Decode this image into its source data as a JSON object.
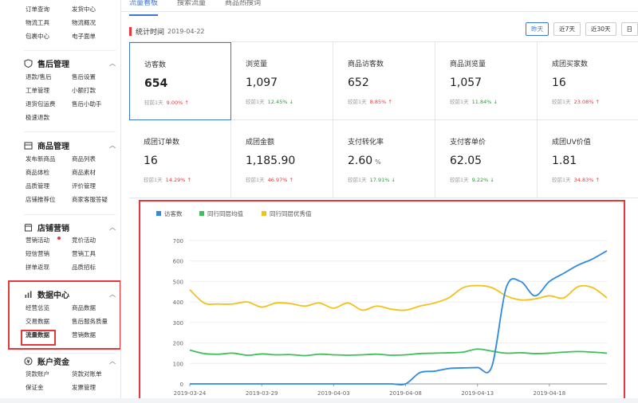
{
  "sidebar": {
    "top_links": [
      "订单查询",
      "发货中心",
      "物流工具",
      "物流概况",
      "包裹中心",
      "电子面单"
    ],
    "sections": [
      {
        "title": "售后管理",
        "icon": "shield-icon",
        "links": [
          "退款/售后",
          "售后设置",
          "工单管理",
          "小额打款",
          "退货包运费",
          "售后小助手",
          "极速退款"
        ]
      },
      {
        "title": "商品管理",
        "icon": "box-icon",
        "links": [
          "发布新商品",
          "商品列表",
          "商品体检",
          "商品素材",
          "品质管理",
          "评价管理",
          "店铺推荐位",
          "商家客服答疑"
        ]
      },
      {
        "title": "店铺营销",
        "icon": "store-icon",
        "links": [
          "营销活动",
          "竞价活动",
          "短信营销",
          "营销工具",
          "拼单返现",
          "品质招标"
        ]
      },
      {
        "title": "数据中心",
        "icon": "bar-chart-icon",
        "links": [
          "经营总览",
          "商品数据",
          "交易数据",
          "售后服务质量",
          "流量数据",
          "营销数据"
        ]
      },
      {
        "title": "账户资金",
        "icon": "wallet-icon",
        "links": [
          "货款账户",
          "货款对账单",
          "保证金",
          "发票管理"
        ]
      }
    ]
  },
  "tabs": [
    "流量看板",
    "搜索流量",
    "商品热搜词"
  ],
  "stat": {
    "label": "统计时间",
    "date": "2019-04-22"
  },
  "ranges": [
    "昨天",
    "近7天",
    "近30天",
    "日"
  ],
  "compare_label": "较前1天",
  "metrics": [
    {
      "name": "访客数",
      "value": "654",
      "pct": "9.00%",
      "dir": "up",
      "arrow": "↑"
    },
    {
      "name": "浏览量",
      "value": "1,097",
      "pct": "12.45%",
      "dir": "down",
      "arrow": "↓"
    },
    {
      "name": "商品访客数",
      "value": "652",
      "pct": "8.85%",
      "dir": "up",
      "arrow": "↑"
    },
    {
      "name": "商品浏览量",
      "value": "1,057",
      "pct": "11.84%",
      "dir": "down",
      "arrow": "↓"
    },
    {
      "name": "成团买家数",
      "value": "16",
      "pct": "23.08%",
      "dir": "up",
      "arrow": "↑"
    },
    {
      "name": "成团订单数",
      "value": "16",
      "pct": "14.29%",
      "dir": "up",
      "arrow": "↑"
    },
    {
      "name": "成团金额",
      "value": "1,185.90",
      "pct": "46.97%",
      "dir": "up",
      "arrow": "↑"
    },
    {
      "name": "支付转化率",
      "value": "2.60",
      "unit": "%",
      "pct": "17.91%",
      "dir": "down",
      "arrow": "↓"
    },
    {
      "name": "支付客单价",
      "value": "62.05",
      "pct": "9.22%",
      "dir": "down",
      "arrow": "↓"
    },
    {
      "name": "成团UV价值",
      "value": "1.81",
      "pct": "34.83%",
      "dir": "up",
      "arrow": "↑"
    }
  ],
  "colors": {
    "accent": "#3a78d8",
    "up": "#e4393c",
    "down": "#2a9d3a",
    "highlight": "#e4393c"
  },
  "chart_data": {
    "type": "line",
    "legend_position": "top-left",
    "grid": "horizontal",
    "ylim": [
      0,
      700
    ],
    "yticks": [
      0,
      100,
      200,
      300,
      400,
      500,
      600,
      700
    ],
    "x_tick_labels": [
      "2019-03-24",
      "2019-03-29",
      "2019-04-03",
      "2019-04-08",
      "2019-04-13",
      "2019-04-18"
    ],
    "x": [
      "03-24",
      "03-25",
      "03-26",
      "03-27",
      "03-28",
      "03-29",
      "03-30",
      "03-31",
      "04-01",
      "04-02",
      "04-03",
      "04-04",
      "04-05",
      "04-06",
      "04-07",
      "04-08",
      "04-09",
      "04-10",
      "04-11",
      "04-12",
      "04-13",
      "04-14",
      "04-15",
      "04-16",
      "04-17",
      "04-18",
      "04-19",
      "04-20",
      "04-21",
      "04-22"
    ],
    "series": [
      {
        "name": "访客数",
        "color": "#2f8ae0",
        "values": [
          0,
          0,
          0,
          0,
          0,
          0,
          0,
          0,
          0,
          0,
          0,
          0,
          0,
          0,
          0,
          0,
          55,
          62,
          75,
          78,
          80,
          85,
          470,
          500,
          430,
          500,
          540,
          580,
          610,
          650
        ]
      },
      {
        "name": "同行同层均值",
        "color": "#3fbf5a",
        "values": [
          165,
          148,
          145,
          150,
          140,
          146,
          142,
          143,
          138,
          145,
          142,
          140,
          142,
          145,
          140,
          142,
          148,
          150,
          152,
          155,
          170,
          160,
          150,
          152,
          148,
          150,
          155,
          158,
          155,
          150
        ]
      },
      {
        "name": "同行同层优秀值",
        "color": "#f2c218",
        "values": [
          460,
          395,
          390,
          390,
          400,
          375,
          395,
          392,
          380,
          395,
          370,
          395,
          360,
          380,
          365,
          360,
          380,
          395,
          420,
          470,
          480,
          470,
          430,
          410,
          415,
          430,
          420,
          475,
          470,
          420
        ]
      }
    ]
  }
}
